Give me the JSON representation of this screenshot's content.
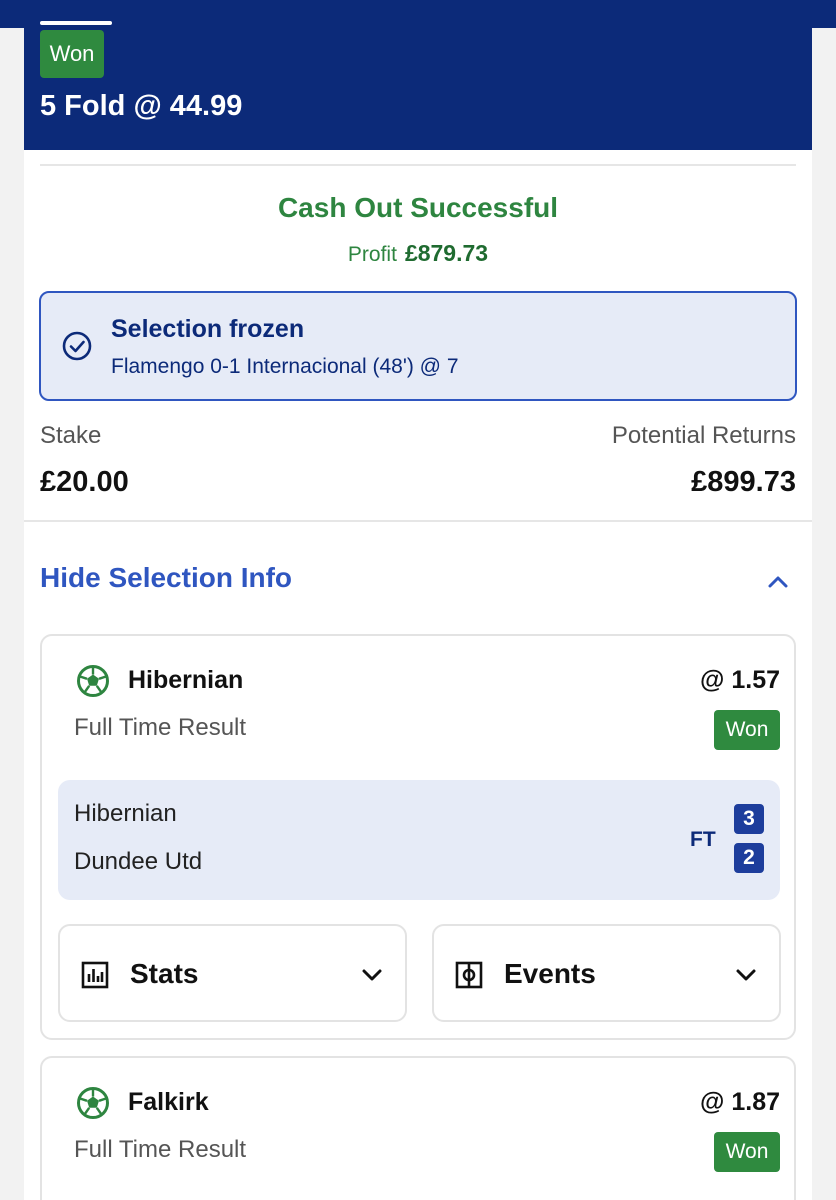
{
  "bet": {
    "status_badge": "Won",
    "title": "5 Fold @ 44.99"
  },
  "cashout": {
    "title": "Cash Out Successful",
    "profit_label": "Profit",
    "profit_value": "£879.73"
  },
  "frozen": {
    "icon": "check-circle-icon",
    "title": "Selection frozen",
    "detail": "Flamengo 0-1 Internacional (48') @ 7"
  },
  "stake": {
    "label": "Stake",
    "value": "£20.00"
  },
  "returns": {
    "label": "Potential Returns",
    "value": "£899.73"
  },
  "selection_info_toggle": "Hide Selection Info",
  "selections": [
    {
      "team": "Hibernian",
      "odds": "@ 1.57",
      "market": "Full Time Result",
      "result": "Won",
      "match": {
        "home": "Hibernian",
        "away": "Dundee Utd",
        "status": "FT",
        "home_score": "3",
        "away_score": "2"
      },
      "tabs": {
        "stats": "Stats",
        "events": "Events"
      }
    },
    {
      "team": "Falkirk",
      "odds": "@ 1.87",
      "market": "Full Time Result",
      "result": "Won"
    }
  ],
  "colors": {
    "brand_navy": "#0c2a79",
    "won_green": "#2f8a3f",
    "link_blue": "#2f56c0",
    "frozen_bg": "#e6ebf7"
  }
}
